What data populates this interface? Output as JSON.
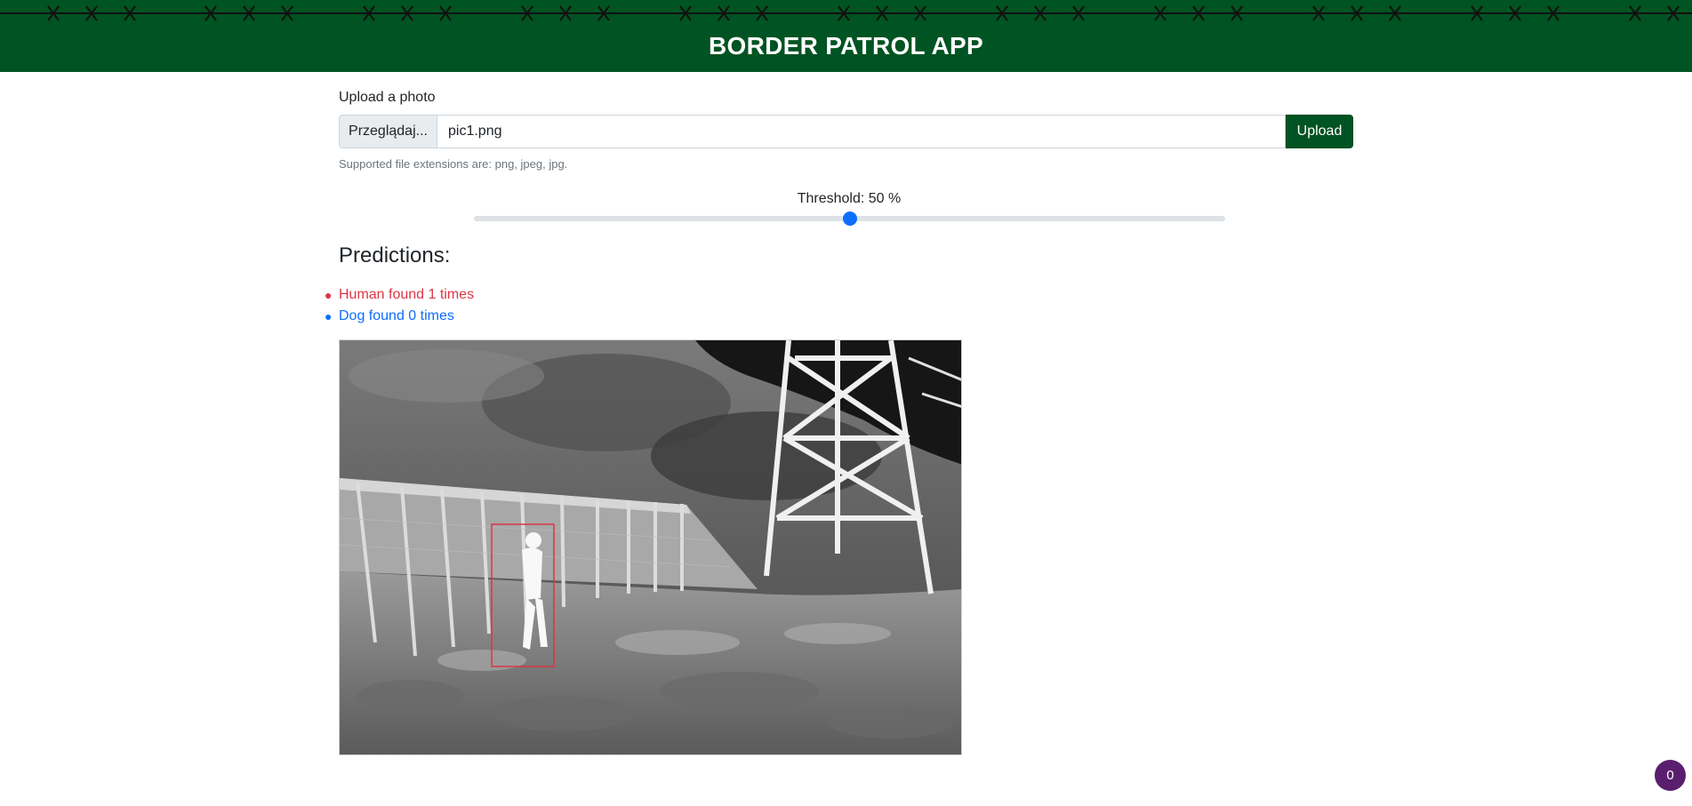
{
  "header": {
    "title": "BORDER PATROL APP"
  },
  "upload": {
    "label": "Upload a photo",
    "browse_label": "Przeglądaj...",
    "filename": "pic1.png",
    "button_label": "Upload",
    "help_text": "Supported file extensions are: png, jpeg, jpg."
  },
  "threshold": {
    "label": "Threshold: 50 %",
    "value_percent": 50
  },
  "predictions": {
    "heading": "Predictions:",
    "items": [
      {
        "text": "Human found 1 times",
        "color": "#dc3545"
      },
      {
        "text": "Dog found 0 times",
        "color": "#0d6efd"
      }
    ]
  },
  "colors": {
    "brand": "#005322",
    "accent": "#0d6efd",
    "human": "#dc3545"
  },
  "badge": {
    "count": "0"
  }
}
